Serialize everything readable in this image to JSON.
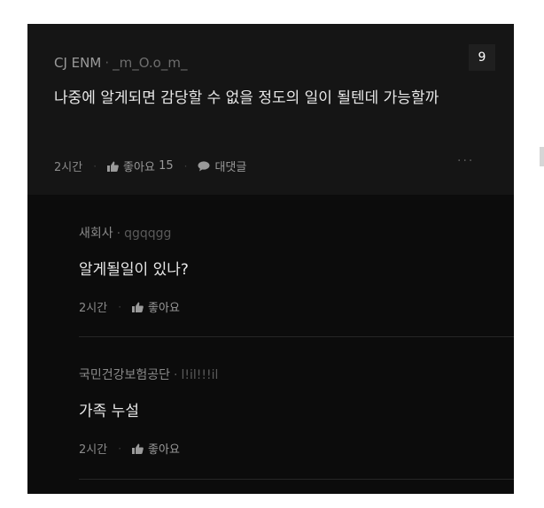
{
  "main_comment": {
    "author": "CJ ENM",
    "separator": "·",
    "handle": "_m_O.o_m_",
    "badge": "9",
    "text": "나중에 알게되면 감당할 수 없을 정도의 일이 될텐데 가능할까",
    "time": "2시간",
    "like_label": "좋아요",
    "like_count": "15",
    "reply_label": "대댓글",
    "more_label": "···",
    "icons": {
      "like": "thumbs-up-icon",
      "reply": "speech-bubble-icon",
      "more": "more-icon"
    }
  },
  "replies": [
    {
      "author": "새회사",
      "separator": "·",
      "handle": "qgqqgg",
      "text": "알게될일이 있나?",
      "time": "2시간",
      "like_label": "좋아요"
    },
    {
      "author": "국민건강보험공단",
      "separator": "·",
      "handle": "l!il!!!il",
      "text": "가족 누설",
      "time": "2시간",
      "like_label": "좋아요"
    }
  ],
  "colors": {
    "background": "#0c0c0c",
    "main_comment_bg": "#151515",
    "text_primary": "#e8e8e8",
    "text_secondary": "#8a8a8a"
  }
}
